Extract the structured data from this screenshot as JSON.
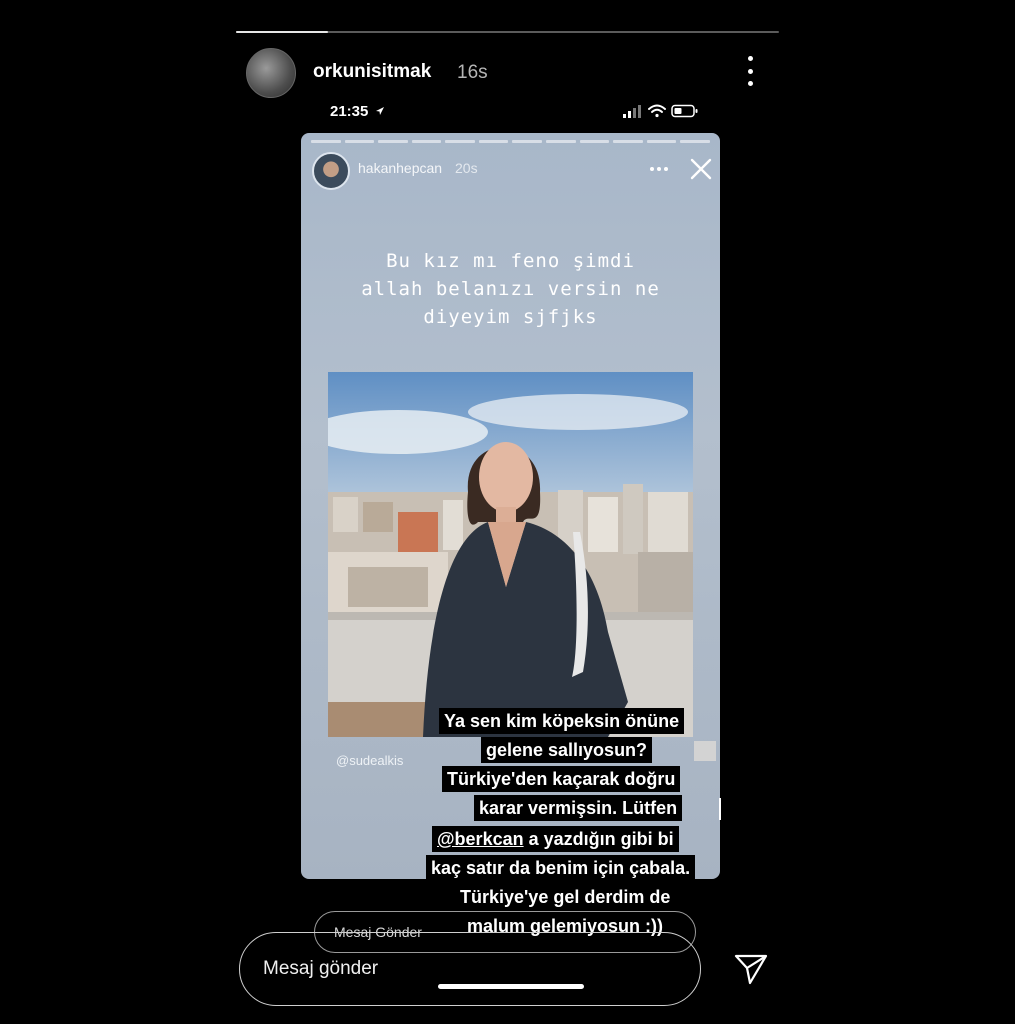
{
  "outer": {
    "username": "orkunisitmak",
    "time_ago": "16s",
    "progress": 0.17
  },
  "status_bar": {
    "time": "21:35"
  },
  "inner_story": {
    "username": "hakanhepcan",
    "time_ago": "20s",
    "typed_text": [
      "Bu kız mı feno şimdi",
      "allah belanızı versin ne",
      "diyeyim sjfjks"
    ],
    "photo_tag": "@sudealkis",
    "reply_placeholder": "Mesaj Gönder"
  },
  "comment": {
    "lines": [
      "Ya sen kim köpeksin önüne",
      "gelene sallıyosun?",
      "Türkiye'den kaçarak doğru",
      "karar vermişsin. Lütfen",
      "a yazdığın gibi bi",
      "kaç satır da benim için çabala.",
      "Türkiye'ye gel derdim de",
      "malum gelemiyosun :))"
    ],
    "mention": "@berkcan"
  },
  "reply": {
    "placeholder": "Mesaj gönder"
  },
  "icons": {
    "more": "more-vertical-icon",
    "send": "paper-plane-icon",
    "close": "close-icon",
    "location": "location-arrow-icon",
    "wifi": "wifi-icon",
    "signal": "signal-icon",
    "battery": "battery-icon"
  }
}
